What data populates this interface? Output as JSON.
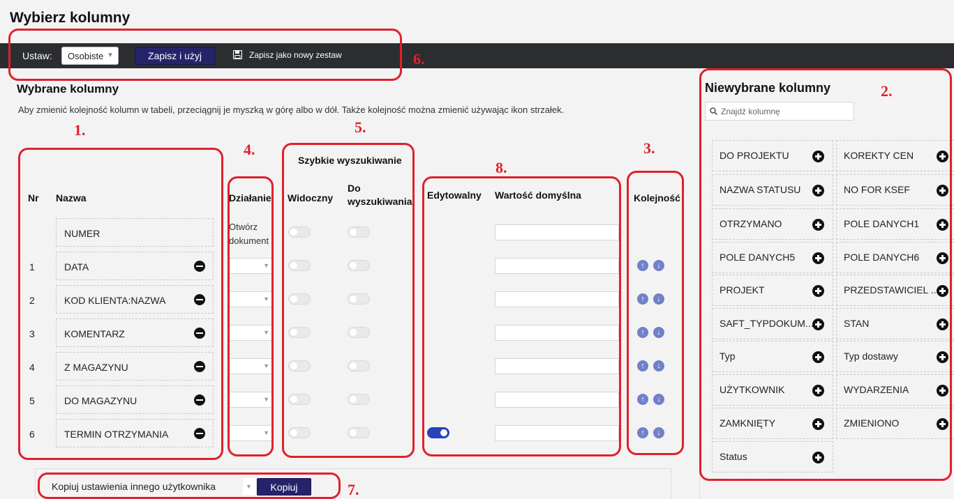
{
  "page": {
    "title": "Wybierz kolumny"
  },
  "toolbar": {
    "set_label": "Ustaw:",
    "set_value": "Osobiste",
    "save_apply": "Zapisz i użyj",
    "save_new": "Zapisz jako nowy zestaw"
  },
  "selected": {
    "title": "Wybrane kolumny",
    "help": "Aby zmienić kolejność kolumn w tabeli, przeciągnij je myszką w górę albo w dół. Także kolejność można zmienić używając ikon strzałek.",
    "headers": {
      "nr": "Nr",
      "name": "Nazwa",
      "action": "Działanie",
      "quick_search": "Szybkie wyszukiwanie",
      "visible": "Widoczny",
      "searchable_1": "Do",
      "searchable_2": "wyszukiwania",
      "editable": "Edytowalny",
      "default_value": "Wartość domyślna",
      "order": "Kolejność"
    },
    "rows": [
      {
        "nr": "",
        "name": "NUMER",
        "action_1": "Otwórz",
        "action_2": "dokument",
        "editable_on": false
      },
      {
        "nr": "1",
        "name": "DATA",
        "editable_on": false
      },
      {
        "nr": "2",
        "name": "KOD KLIENTA:NAZWA",
        "editable_on": false
      },
      {
        "nr": "3",
        "name": "KOMENTARZ",
        "editable_on": false
      },
      {
        "nr": "4",
        "name": "Z MAGAZYNU",
        "editable_on": false
      },
      {
        "nr": "5",
        "name": "DO MAGAZYNU",
        "editable_on": false
      },
      {
        "nr": "6",
        "name": "TERMIN OTRZYMANIA",
        "editable_on": true
      }
    ]
  },
  "unselected": {
    "title": "Niewybrane kolumny",
    "search_placeholder": "Znajdź kolumnę",
    "items": [
      "DO PROJEKTU",
      "KOREKTY CEN",
      "NAZWA STATUSU",
      "NO FOR KSEF",
      "OTRZYMANO",
      "POLE DANYCH1",
      "POLE DANYCH5",
      "POLE DANYCH6",
      "PROJEKT",
      "PRZEDSTAWICIEL ...",
      "SAFT_TYPDOKUM...",
      "STAN",
      "Typ",
      "Typ dostawy",
      "UŻYTKOWNIK",
      "WYDARZENIA",
      "ZAMKNIĘTY",
      "ZMIENIONO",
      "Status"
    ]
  },
  "copy": {
    "label": "Kopiuj ustawienia innego użytkownika",
    "button": "Kopiuj"
  },
  "annotations": [
    "1.",
    "2.",
    "3.",
    "4.",
    "5.",
    "6.",
    "7.",
    "8."
  ],
  "colors": {
    "annotation": "#e0202b",
    "primary_button": "#25246b",
    "toolbar": "#2b2d31",
    "toggle_on": "#2643b9",
    "arrow": "#7180c9"
  }
}
